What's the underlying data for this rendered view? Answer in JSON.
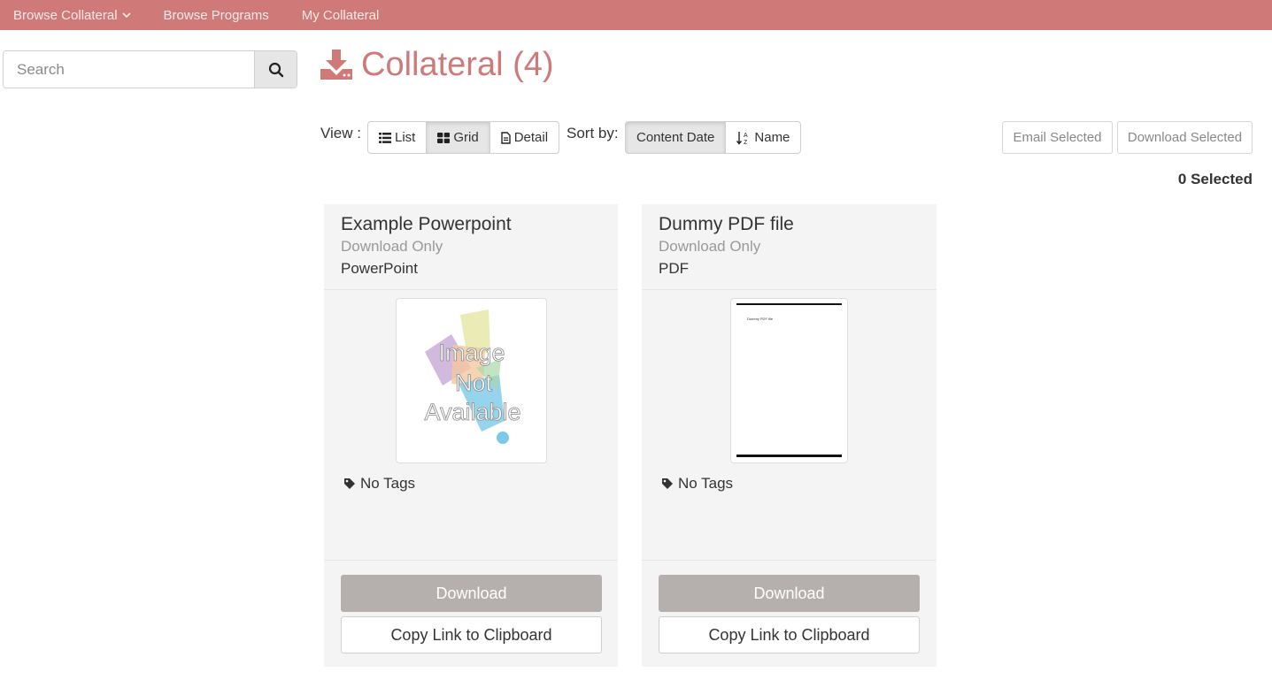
{
  "nav": {
    "items": [
      {
        "label": "Browse Collateral",
        "dropdown": true
      },
      {
        "label": "Browse Programs",
        "dropdown": false
      },
      {
        "label": "My Collateral",
        "dropdown": false
      }
    ]
  },
  "search": {
    "placeholder": "Search"
  },
  "header": {
    "title": "Collateral (4)"
  },
  "toolbar": {
    "view_label": "View :",
    "view_options": [
      {
        "label": "List",
        "icon": "list-icon",
        "active": false
      },
      {
        "label": "Grid",
        "icon": "grid-icon",
        "active": true
      },
      {
        "label": "Detail",
        "icon": "file-icon",
        "active": false
      }
    ],
    "sort_label": "Sort by:",
    "sort_options": [
      {
        "label": "Content Date",
        "active": true
      },
      {
        "label": "Name",
        "icon": "sort-alpha-icon",
        "active": false
      }
    ],
    "email_label": "Email Selected",
    "download_label": "Download Selected",
    "selected_text": "0 Selected"
  },
  "cards": [
    {
      "title": "Example Powerpoint",
      "subtype": "Download Only",
      "file_type": "PowerPoint",
      "thumbnail": "image-not-available",
      "thumb_text": [
        "Image",
        "Not",
        "Available"
      ],
      "tags": "No Tags",
      "download_label": "Download",
      "copy_label": "Copy Link to Clipboard"
    },
    {
      "title": "Dummy PDF file",
      "subtype": "Download Only",
      "file_type": "PDF",
      "thumbnail": "pdf-page",
      "thumb_text": [
        "Dummy PDF file"
      ],
      "tags": "No Tags",
      "download_label": "Download",
      "copy_label": "Copy Link to Clipboard"
    }
  ],
  "colors": {
    "brand": "#cf7a78",
    "download_button": "#b5b0ae"
  }
}
